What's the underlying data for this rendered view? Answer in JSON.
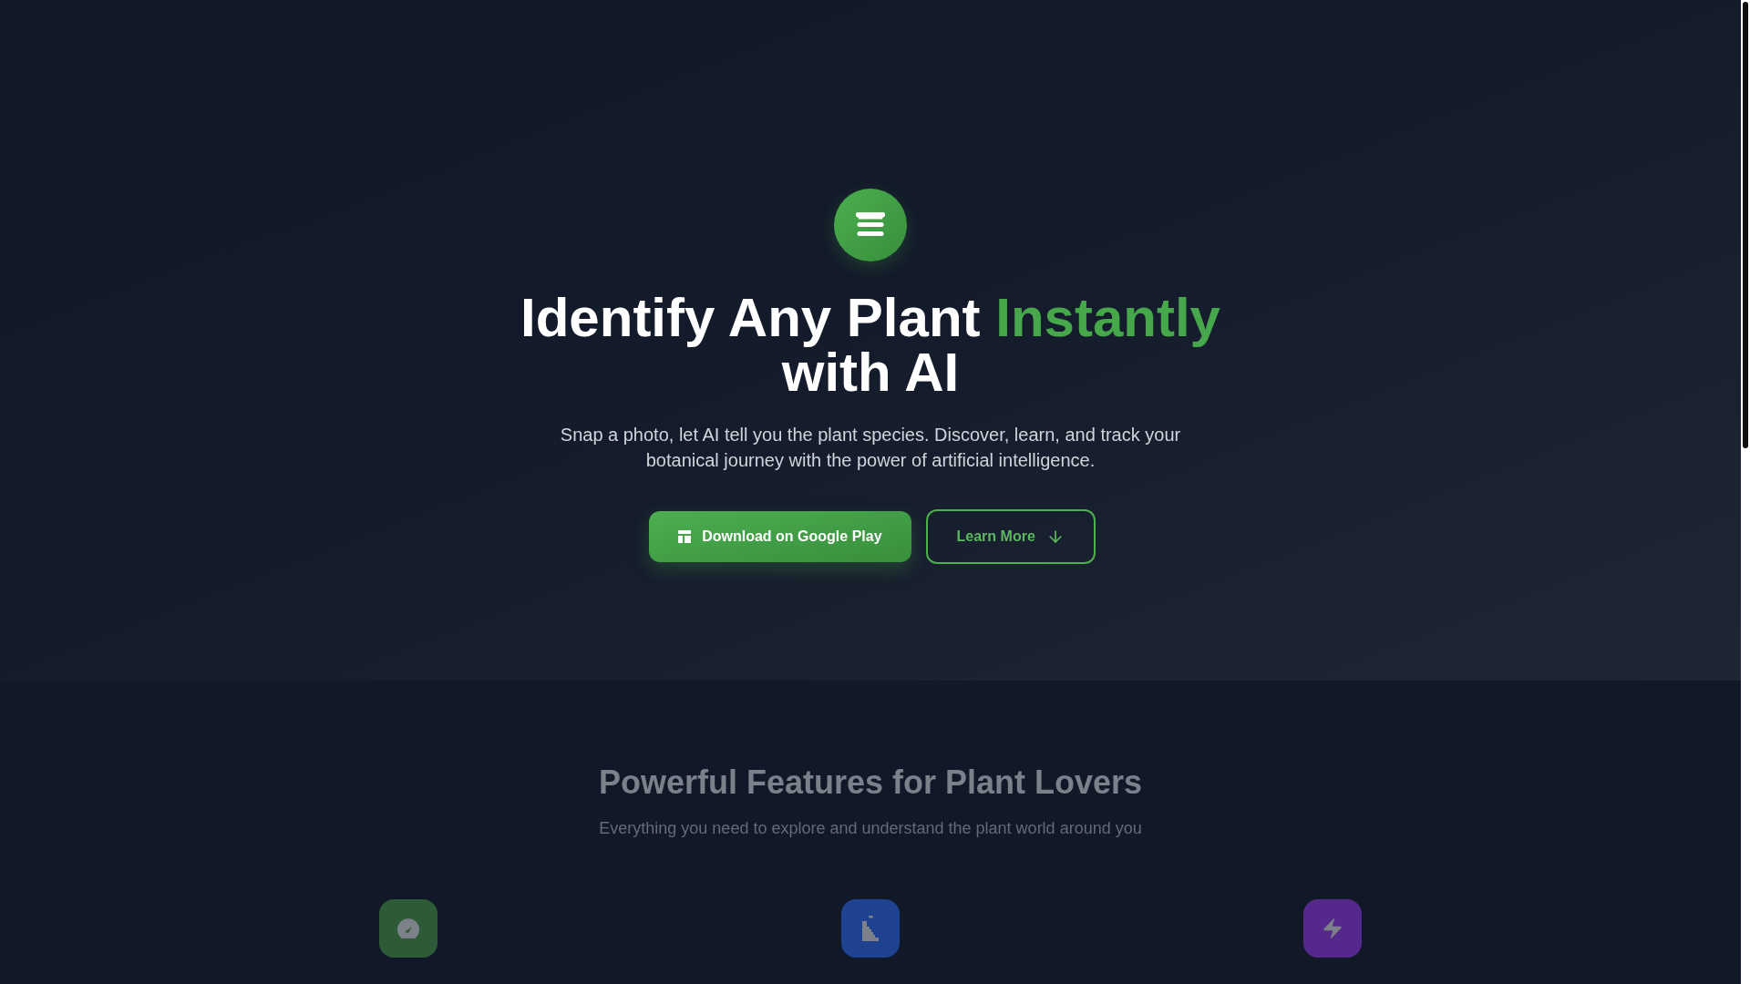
{
  "hero": {
    "heading": {
      "lead": "Identify Any Plant",
      "highlight": "Instantly",
      "tail": "with AI"
    },
    "description": "Snap a photo, let AI tell you the plant species. Discover, learn, and track your botanical journey with the power of artificial intelligence.",
    "buttons": [
      {
        "kind": "primary",
        "label": "Download on Google Play"
      },
      {
        "kind": "outline",
        "label": "Learn More"
      }
    ]
  },
  "features": {
    "title": "Powerful Features for Plant Lovers",
    "subtitle": "Everything you need to explore and understand the plant world around you",
    "items": [
      {
        "kind": "gauge",
        "color": "#2d5a37"
      },
      {
        "kind": "stairs",
        "color": "#1f4391"
      },
      {
        "kind": "bolt",
        "color": "#55298b"
      }
    ]
  }
}
